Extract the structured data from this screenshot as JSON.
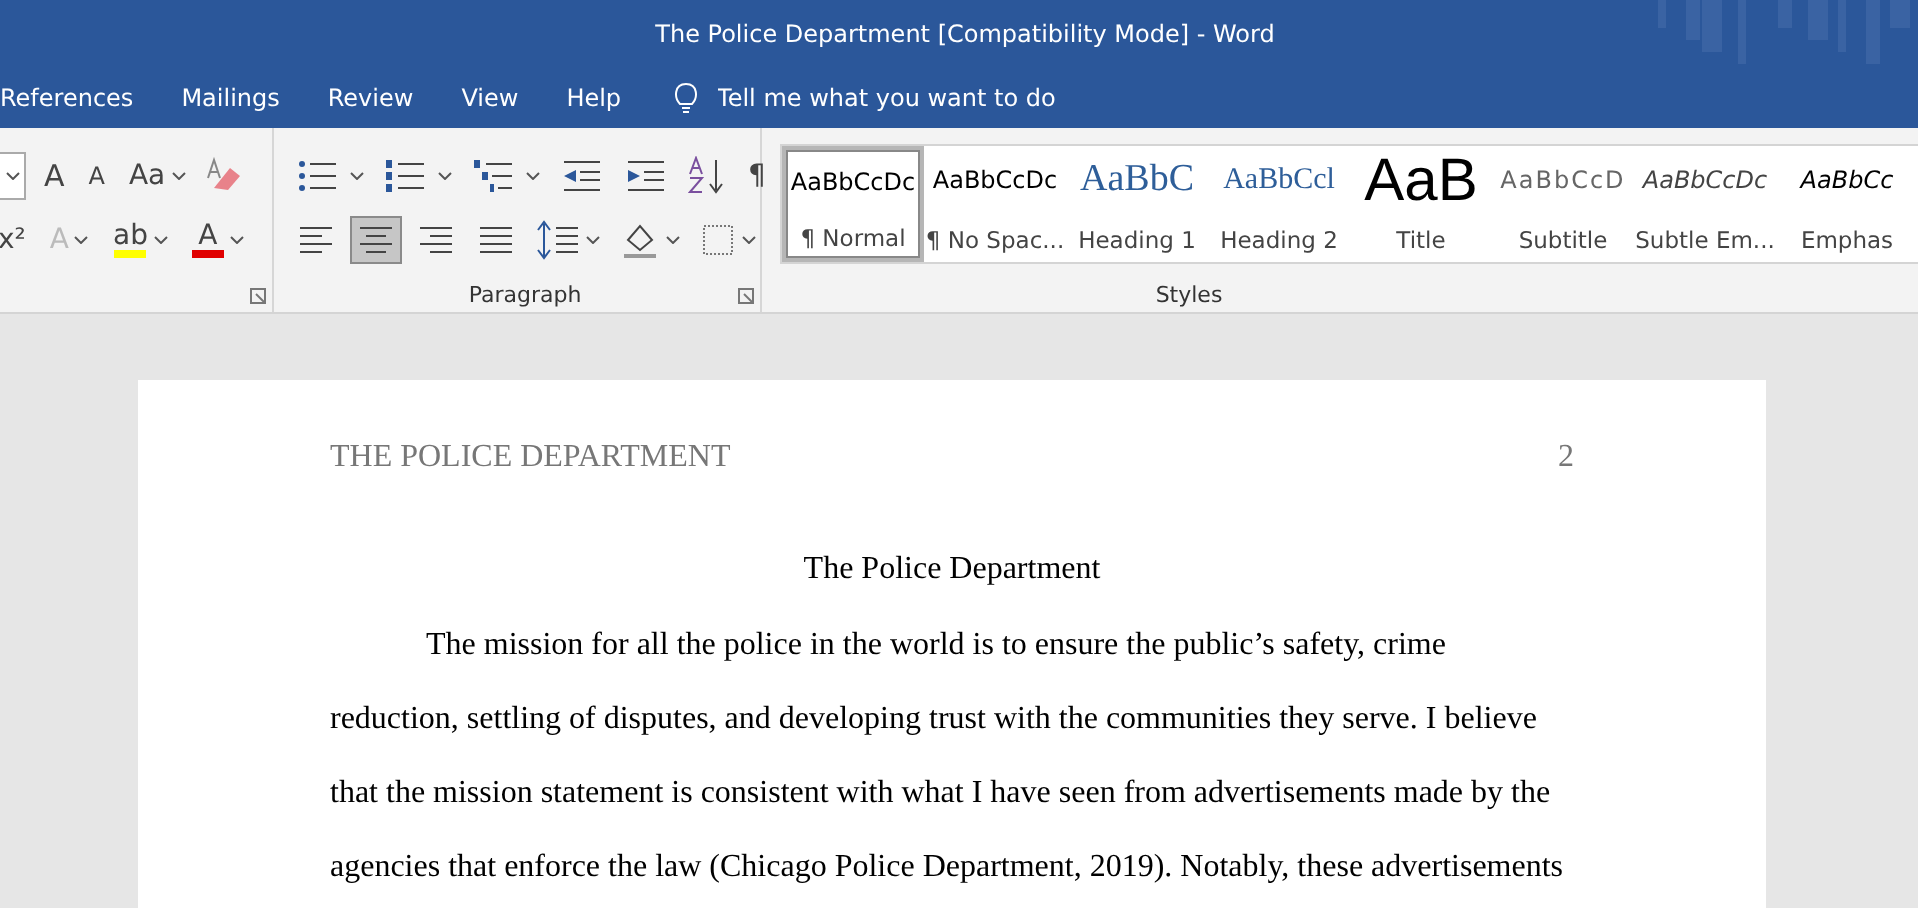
{
  "window": {
    "title": "The Police Department [Compatibility Mode]  -  Word"
  },
  "tabs": [
    {
      "label": "References",
      "selected": false
    },
    {
      "label": "Mailings",
      "selected": false
    },
    {
      "label": "Review",
      "selected": false
    },
    {
      "label": "View",
      "selected": false
    },
    {
      "label": "Help",
      "selected": false
    }
  ],
  "tell_me": {
    "placeholder": "Tell me what you want to do"
  },
  "font_group": {
    "row_1": [
      {
        "kind": "size-drop"
      },
      {
        "kind": "grow",
        "glyph": "A"
      },
      {
        "kind": "shrink",
        "glyph": "A"
      },
      {
        "kind": "case",
        "glyph": "Aa"
      },
      {
        "kind": "clear"
      }
    ],
    "row_2": [
      {
        "kind": "super",
        "glyph": "x²"
      },
      {
        "kind": "effects",
        "glyph": "A",
        "disabled": true
      },
      {
        "kind": "highlight",
        "glyph": "ab",
        "color": "#ffff00"
      },
      {
        "kind": "fontcolor",
        "glyph": "A",
        "color": "#e00000"
      }
    ]
  },
  "paragraph_group": {
    "label": "Paragraph",
    "row_1": [
      {
        "kind": "bullets",
        "selected": false
      },
      {
        "kind": "numbering",
        "selected": false
      },
      {
        "kind": "multilevel",
        "selected": false
      },
      {
        "kind": "outdent",
        "selected": false
      },
      {
        "kind": "indent",
        "selected": false
      },
      {
        "kind": "sort",
        "selected": false
      },
      {
        "kind": "pilcrow",
        "glyph": "¶",
        "selected": false
      }
    ],
    "row_2": [
      {
        "kind": "align-left",
        "selected": false
      },
      {
        "kind": "align-center",
        "selected": true
      },
      {
        "kind": "align-right",
        "selected": false
      },
      {
        "kind": "justify",
        "selected": false
      },
      {
        "kind": "spacing",
        "selected": false
      },
      {
        "kind": "shading",
        "selected": false
      },
      {
        "kind": "borders",
        "selected": false
      }
    ]
  },
  "styles_group": {
    "label": "Styles",
    "items": [
      {
        "preview": "AaBbCcDc",
        "label": "¶ Normal",
        "kind": "normal",
        "selected": true
      },
      {
        "preview": "AaBbCcDc",
        "label": "¶ No Spac...",
        "kind": "normal",
        "selected": false
      },
      {
        "preview": "AaBbC",
        "label": "Heading 1",
        "kind": "heading1",
        "selected": false
      },
      {
        "preview": "AaBbCcl",
        "label": "Heading 2",
        "kind": "heading2",
        "selected": false
      },
      {
        "preview": "AaB",
        "label": "Title",
        "kind": "title",
        "selected": false
      },
      {
        "preview": "AaBbCcD",
        "label": "Subtitle",
        "kind": "subtitle",
        "selected": false
      },
      {
        "preview": "AaBbCcDc",
        "label": "Subtle Em...",
        "kind": "subtle",
        "selected": false
      },
      {
        "preview": "AaBbCc",
        "label": "Emphas",
        "kind": "emphasis",
        "selected": false
      }
    ]
  },
  "document": {
    "header": "THE POLICE DEPARTMENT",
    "page_number": "2",
    "title": "The Police Department",
    "paragraph": "The mission for all the police in the world is to ensure the public’s safety, crime reduction, settling of disputes, and developing trust with the communities they serve. I believe that the mission statement is consistent with what I have seen from advertisements made by the agencies that enforce the law (Chicago Police Department, 2019). Notably, these advertisements"
  }
}
